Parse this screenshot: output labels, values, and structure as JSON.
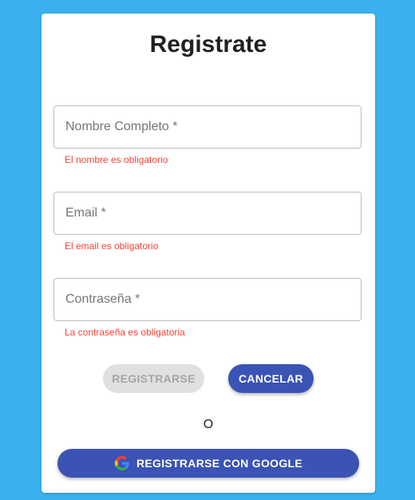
{
  "title": "Registrate",
  "fields": [
    {
      "placeholder": "Nombre Completo *",
      "value": "",
      "error": "El nombre es obligatorio"
    },
    {
      "placeholder": "Email *",
      "value": "",
      "error": "El email es obligatorio"
    },
    {
      "placeholder": "Contraseña *",
      "value": "",
      "error": "La contraseña es obligatoria"
    }
  ],
  "buttons": {
    "register": "REGISTRARSE",
    "cancel": "CANCELAR",
    "google": "REGISTRARSE CON GOOGLE"
  },
  "separator": "O",
  "colors": {
    "background": "#3ab0ee",
    "primary": "#3a53b5",
    "error": "#f44336"
  },
  "icons": {
    "google": "google-logo-icon"
  }
}
